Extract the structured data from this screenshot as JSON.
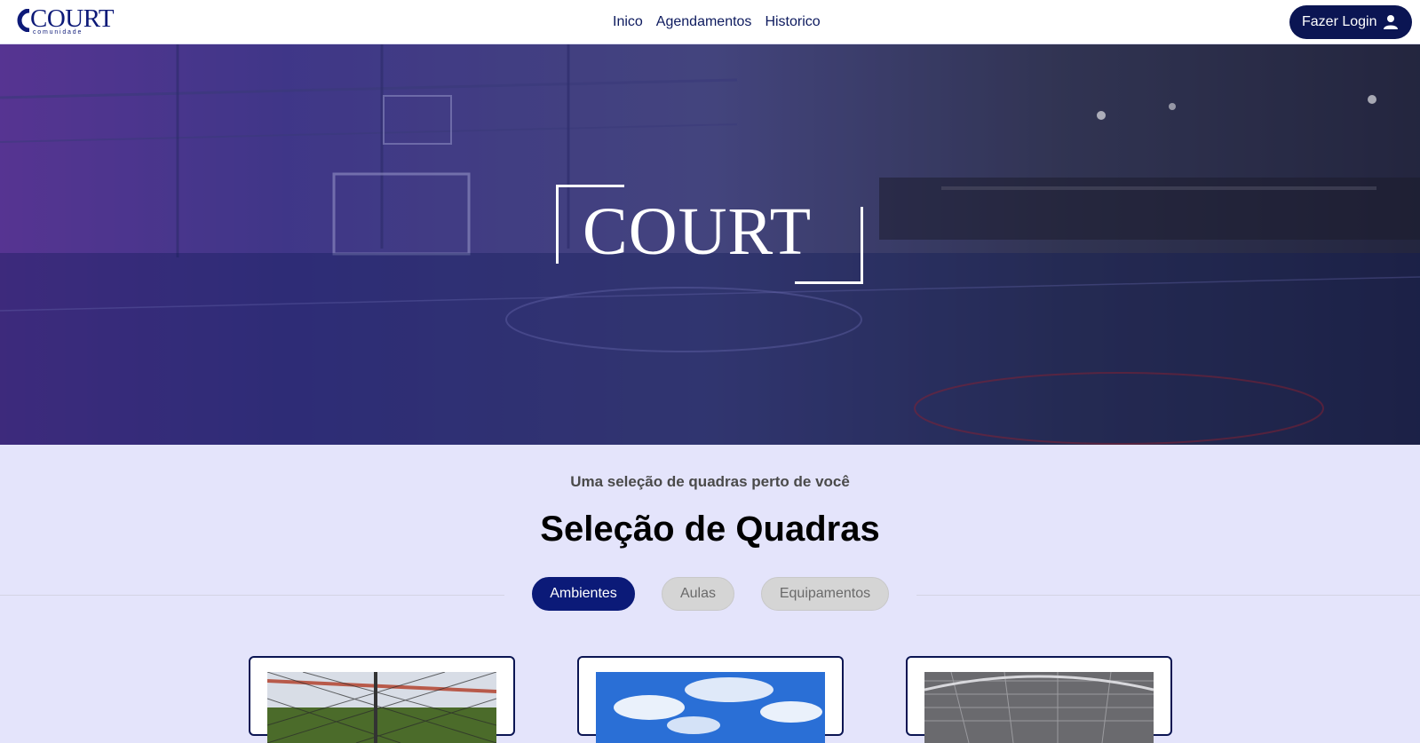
{
  "header": {
    "logo_text": "COURT",
    "logo_tagline": "comunidade",
    "nav": [
      {
        "label": "Inico"
      },
      {
        "label": "Agendamentos"
      },
      {
        "label": "Historico"
      }
    ],
    "login_label": "Fazer Login"
  },
  "hero": {
    "logo_text": "COURT"
  },
  "section": {
    "subtitle": "Uma seleção de quadras perto de você",
    "title": "Seleção de Quadras",
    "tabs": [
      {
        "label": "Ambientes",
        "active": true
      },
      {
        "label": "Aulas",
        "active": false
      },
      {
        "label": "Equipamentos",
        "active": false
      }
    ]
  },
  "cards": [
    {
      "image": "outdoor-court-net-photo"
    },
    {
      "image": "blue-sky-clouds-photo"
    },
    {
      "image": "covered-gym-roof-photo"
    }
  ],
  "colors": {
    "brand": "#0b1a78",
    "navy": "#0b1553",
    "page_bg": "#e4e4fb"
  },
  "icons": {
    "login": "user-icon",
    "logo": "c-mark-icon"
  }
}
